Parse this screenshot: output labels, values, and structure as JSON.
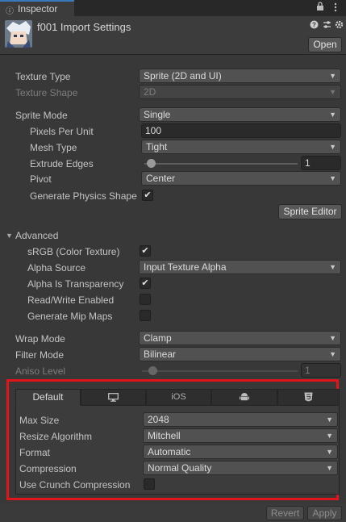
{
  "window": {
    "tab_icon": "info-icon",
    "tab_title": "Inspector",
    "toolbar_icons": [
      "lock-icon",
      "kebab-menu-icon"
    ]
  },
  "header": {
    "asset_icon": "texture-thumbnail",
    "title": "f001 Import Settings",
    "icons": [
      "help-icon",
      "preset-icon",
      "gear-icon"
    ],
    "open_label": "Open"
  },
  "texture": {
    "type_label": "Texture Type",
    "type_value": "Sprite (2D and UI)",
    "shape_label": "Texture Shape",
    "shape_value": "2D"
  },
  "sprite": {
    "mode_label": "Sprite Mode",
    "mode_value": "Single",
    "ppu_label": "Pixels Per Unit",
    "ppu_value": "100",
    "mesh_label": "Mesh Type",
    "mesh_value": "Tight",
    "extrude_label": "Extrude Edges",
    "extrude_value": "1",
    "extrude_level": 0.02,
    "pivot_label": "Pivot",
    "pivot_value": "Center",
    "physics_label": "Generate Physics Shape",
    "physics_checked": true,
    "editor_label": "Sprite Editor"
  },
  "advanced": {
    "title": "Advanced",
    "srgb_label": "sRGB (Color Texture)",
    "srgb_checked": true,
    "alpha_source_label": "Alpha Source",
    "alpha_source_value": "Input Texture Alpha",
    "alpha_transp_label": "Alpha Is Transparency",
    "alpha_transp_checked": true,
    "rw_label": "Read/Write Enabled",
    "rw_checked": false,
    "mip_label": "Generate Mip Maps",
    "mip_checked": false
  },
  "wrap": {
    "wrap_label": "Wrap Mode",
    "wrap_value": "Clamp",
    "filter_label": "Filter Mode",
    "filter_value": "Bilinear",
    "aniso_label": "Aniso Level",
    "aniso_value": "1",
    "aniso_level": 0.0
  },
  "platform": {
    "tabs": [
      {
        "label": "Default",
        "icon": null
      },
      {
        "label": "",
        "icon": "monitor-icon"
      },
      {
        "label": "iOS",
        "icon": null
      },
      {
        "label": "",
        "icon": "android-icon"
      },
      {
        "label": "",
        "icon": "html5-icon"
      }
    ],
    "max_size_label": "Max Size",
    "max_size_value": "2048",
    "resize_label": "Resize Algorithm",
    "resize_value": "Mitchell",
    "format_label": "Format",
    "format_value": "Automatic",
    "compression_label": "Compression",
    "compression_value": "Normal Quality",
    "crunch_label": "Use Crunch Compression",
    "crunch_checked": false,
    "highlight_color": "#e0151c"
  },
  "footer": {
    "revert_label": "Revert",
    "apply_label": "Apply"
  }
}
